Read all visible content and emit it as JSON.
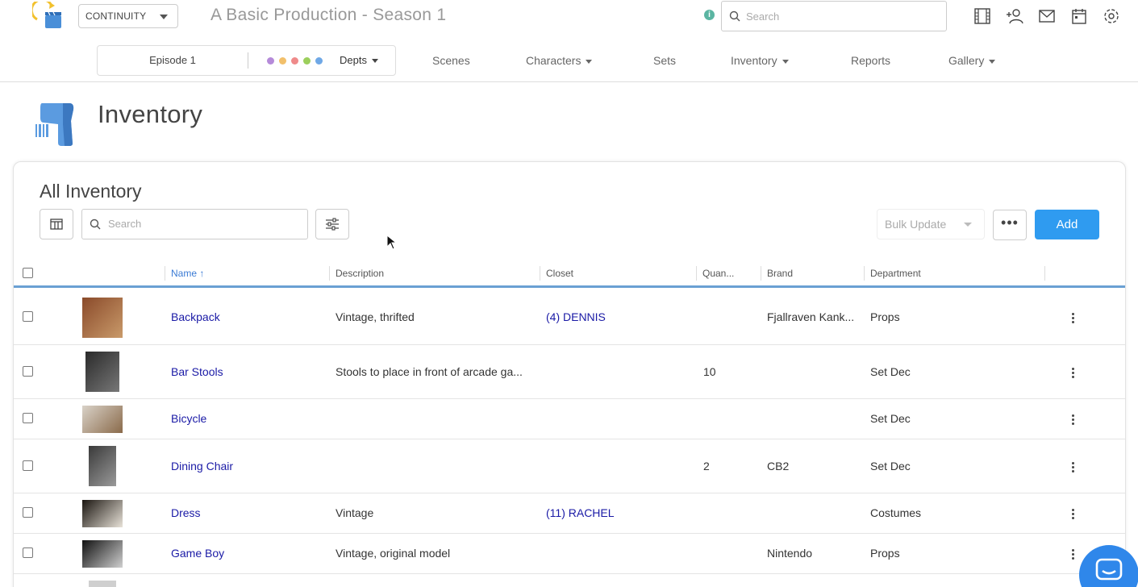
{
  "header": {
    "app_selector": "CONTINUITY",
    "production_title": "A Basic Production - Season 1",
    "search_placeholder": "Search",
    "info_icon": "i"
  },
  "nav": {
    "episode": "Episode 1",
    "depts_label": "Depts",
    "dept_colors": [
      "#b58ad9",
      "#f2c06b",
      "#ef8a8a",
      "#9ccf5c",
      "#6fa8e6"
    ],
    "items": [
      {
        "label": "Scenes",
        "dropdown": false
      },
      {
        "label": "Characters",
        "dropdown": true
      },
      {
        "label": "Sets",
        "dropdown": false
      },
      {
        "label": "Inventory",
        "dropdown": true
      },
      {
        "label": "Reports",
        "dropdown": false
      },
      {
        "label": "Gallery",
        "dropdown": true
      }
    ]
  },
  "page": {
    "title": "Inventory"
  },
  "card": {
    "title": "All Inventory",
    "search_placeholder": "Search",
    "bulk_update": "Bulk Update",
    "more": "•••",
    "add": "Add"
  },
  "table": {
    "columns": [
      "Name",
      "Description",
      "Closet",
      "Quan...",
      "Brand",
      "Department"
    ],
    "sort_indicator": "↑",
    "rows": [
      {
        "name": "Backpack",
        "description": "Vintage, thrifted",
        "closet": "(4) DENNIS",
        "quantity": "",
        "brand": "Fjallraven Kank...",
        "department": "Props",
        "thumb_colors": [
          "#8a4a2a",
          "#c99a6a"
        ]
      },
      {
        "name": "Bar Stools",
        "description": "Stools to place in front of arcade ga...",
        "closet": "",
        "quantity": "10",
        "brand": "",
        "department": "Set Dec",
        "thumb_colors": [
          "#2a2a2a",
          "#777777"
        ]
      },
      {
        "name": "Bicycle",
        "description": "",
        "closet": "",
        "quantity": "",
        "brand": "",
        "department": "Set Dec",
        "thumb_colors": [
          "#d9d2c8",
          "#8a6a4a"
        ]
      },
      {
        "name": "Dining Chair",
        "description": "",
        "closet": "",
        "quantity": "2",
        "brand": "CB2",
        "department": "Set Dec",
        "thumb_colors": [
          "#3a3a3a",
          "#9a9a9a"
        ]
      },
      {
        "name": "Dress",
        "description": "Vintage",
        "closet": "(11) RACHEL",
        "quantity": "",
        "brand": "",
        "department": "Costumes",
        "thumb_colors": [
          "#1a1510",
          "#e8e2d8"
        ]
      },
      {
        "name": "Game Boy",
        "description": "Vintage, original model",
        "closet": "",
        "quantity": "",
        "brand": "Nintendo",
        "department": "Props",
        "thumb_colors": [
          "#111111",
          "#cfcfcf"
        ]
      }
    ]
  }
}
